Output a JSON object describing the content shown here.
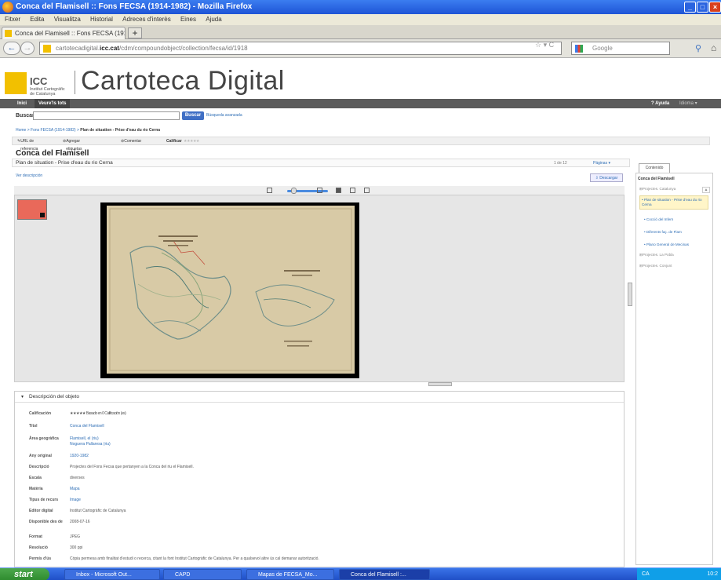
{
  "window": {
    "title": "Conca del Flamisell :: Fons FECSA (1914-1982) - Mozilla Firefox",
    "controls": [
      "_",
      "□",
      "×"
    ]
  },
  "menubar": [
    "Fitxer",
    "Edita",
    "Visualitza",
    "Historial",
    "Adreces d'interès",
    "Eines",
    "Ajuda"
  ],
  "tabs": [
    {
      "label": "Conca del Flamisell :: Fons FECSA (1914-198..."
    }
  ],
  "new_tab_label": "+",
  "navbar": {
    "back": "←",
    "forward": "→",
    "url_prefix": "cartotecadigital.",
    "url_domain": "icc.cat",
    "url_suffix": "/cdm/compoundobject/collection/fecsa/id/1918",
    "reload": "☆ ▾ C",
    "search_placeholder": "Google",
    "search_icon": "⚲",
    "home_icon": "⌂"
  },
  "header": {
    "logo_icc": "ICC",
    "logo_sub": "Institut Cartogràfic de Catalunya",
    "site_title": "Cartoteca Digital"
  },
  "sitenav": {
    "items": [
      "Inici",
      "Veure'ls tots"
    ],
    "right": [
      "? Ayuda",
      "Idioma ▾"
    ]
  },
  "search": {
    "label": "Buscar",
    "value": "",
    "button": "Buscar",
    "advanced": "Búsqueda avanzada"
  },
  "breadcrumb": {
    "trail": "Home > Fons FECSA (1914-1982) > ",
    "current": "Plan de situation - Prise d'eau du rio Cerna"
  },
  "tools": {
    "url": "URL de referencia",
    "tags": "Agregar etiquetas",
    "comment": "Comentar",
    "rate": "Calificar",
    "stars": "★★★★★"
  },
  "object": {
    "title": "Conca del Flamisell",
    "page_title": "Plan de situation - Prise d'eau du rio Cerna",
    "page_count": "1 de 12",
    "pages_menu": "Páginas ▾",
    "view_description": "Ver descripción",
    "download": "Descargar"
  },
  "viewer": {
    "toolbar_icons": [
      "zoom-out-icon",
      "zoom-in-icon",
      "fit-window-icon",
      "fit-width-icon",
      "full-size-icon"
    ],
    "zoom_level": 0.15
  },
  "sidebar": {
    "tab": "Contenido",
    "heading": "Conca del Flamisell",
    "items": [
      {
        "label": "Projectes. Catalunya",
        "type": "folder"
      },
      {
        "label": "Plan de situation - Prise d'eau du rio Cerna",
        "type": "selected"
      },
      {
        "label": "Cocció del Infern",
        "type": "page"
      },
      {
        "label": "Diferents faç. de Flam",
        "type": "page"
      },
      {
        "label": "Plano General de Mecinas",
        "type": "page"
      },
      {
        "label": "Projectes. La Pobla",
        "type": "folder"
      },
      {
        "label": "Projectes. Conjunt",
        "type": "folder"
      }
    ]
  },
  "description": {
    "heading": "Descripción del objeto",
    "rows": [
      {
        "key": "Calificación",
        "value": "★★★★★  Basado en 0 Calificación (es)",
        "link": false
      },
      {
        "key": "Títol",
        "value": "Conca del Flamisell",
        "link": true
      },
      {
        "key": "Àrea geogràfica",
        "value": "Flamisell, el (riu)",
        "value2": "Noguera Pallaresa (riu)",
        "link": true
      },
      {
        "key": "Any original",
        "value": "1920-1982",
        "link": true
      },
      {
        "key": "Descripció",
        "value": "Projectes del Fons Fecsa que pertanyen a la Conca del riu el Flamisell.",
        "link": false
      },
      {
        "key": "Escala",
        "value": "diverses",
        "link": false
      },
      {
        "key": "Matèria",
        "value": "Mapa",
        "link": true
      },
      {
        "key": "Tipus de recurs",
        "value": "Image",
        "link": true
      },
      {
        "key": "Editor digital",
        "value": "Institut Cartogràfic de Catalunya",
        "link": false
      },
      {
        "key": "Disponible des de",
        "value": "2008-07-16",
        "link": false
      },
      {
        "key": "Format",
        "value": "JPEG",
        "link": false
      },
      {
        "key": "Resolució",
        "value": "300 ppi",
        "link": false
      },
      {
        "key": "Permís d'ús",
        "value": "Còpia permesa amb finalitat d'estudi o recerca, citant la font Institut Cartogràfic de Catalunya. Per a qualsevol altre ús cal demanar autorització.",
        "link": false
      }
    ]
  },
  "taskbar": {
    "start": "start",
    "items": [
      "Inbox - Microsoft Out...",
      "CAPD",
      "Mapas de FECSA_Mo...",
      "Conca del Flamisell :..."
    ],
    "tray_lang": "CA",
    "clock": "10:2"
  },
  "colors": {
    "link": "#2d6db5",
    "logo": "#f2c000",
    "nav_bg": "#5c5c5c",
    "map_paper": "#d8caa6"
  }
}
